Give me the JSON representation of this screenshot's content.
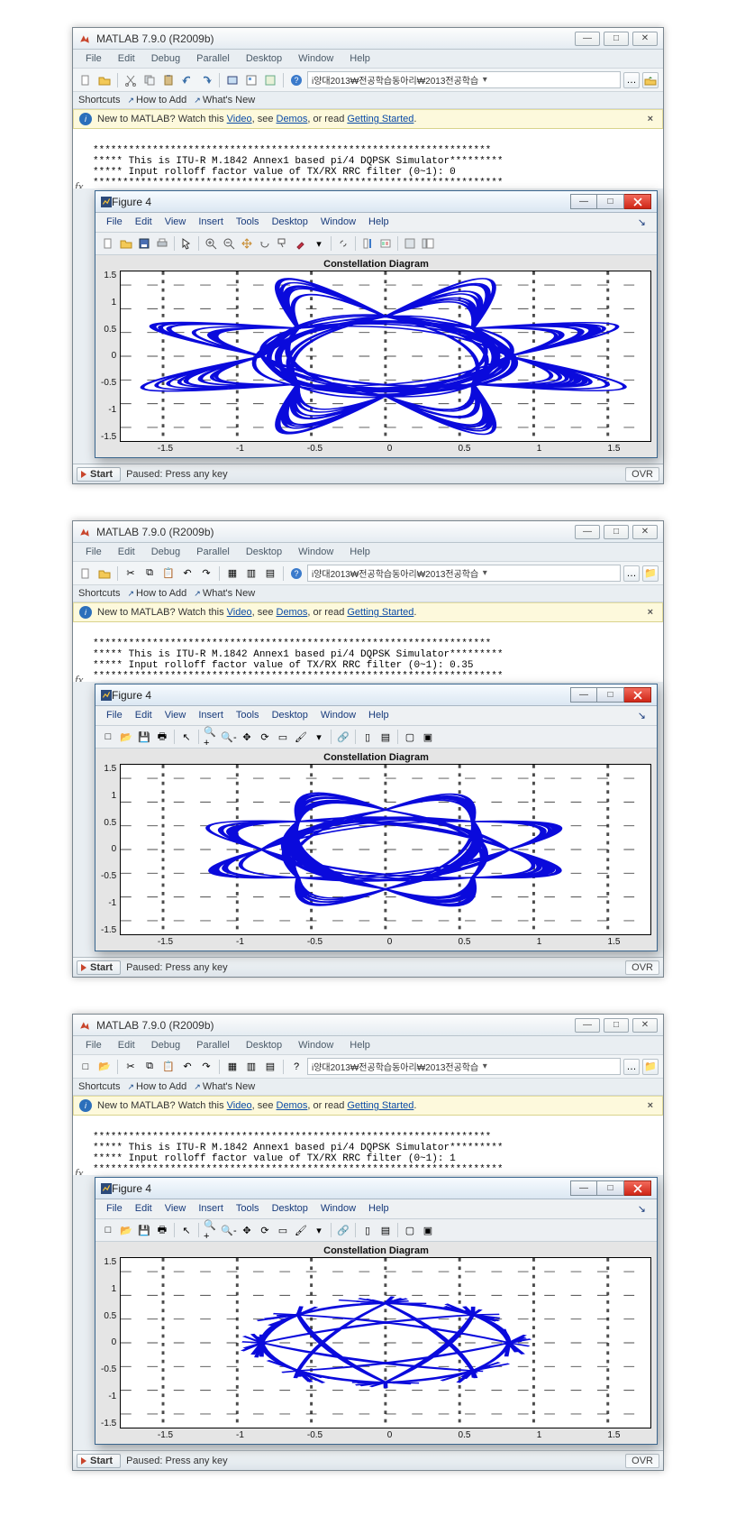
{
  "main": {
    "title": "MATLAB  7.9.0 (R2009b)",
    "menus": [
      "File",
      "Edit",
      "Debug",
      "Parallel",
      "Desktop",
      "Window",
      "Help"
    ],
    "shortcuts_label": "Shortcuts",
    "howto": "How to Add",
    "whatsnew": "What's New",
    "info_prefix": "New to MATLAB? Watch this ",
    "info_video": "Video",
    "info_mid": ", see ",
    "info_demos": "Demos",
    "info_mid2": ", or read ",
    "info_gs": "Getting Started",
    "info_suffix": ".",
    "path": "i양대2013₩전공학습동아리₩2013전공학습",
    "status": "Paused: Press any key",
    "start": "Start",
    "ovr": "OVR"
  },
  "figure": {
    "title": "Figure 4",
    "menus": [
      "File",
      "Edit",
      "View",
      "Insert",
      "Tools",
      "Desktop",
      "Window",
      "Help"
    ],
    "plot_title": "Constellation Diagram"
  },
  "console0": {
    "l1": "*******************************************************************",
    "l2": "***** This is ITU-R M.1842 Annex1 based pi/4 DQPSK Simulator*********",
    "l3": "***** Input rolloff factor value of TX/RX RRC filter (0~1): 0",
    "l4": "*********************************************************************"
  },
  "console1": {
    "l1": "*******************************************************************",
    "l2": "***** This is ITU-R M.1842 Annex1 based pi/4 DQPSK Simulator*********",
    "l3": "***** Input rolloff factor value of TX/RX RRC filter (0~1): 0.35",
    "l4": "*********************************************************************"
  },
  "console2": {
    "l1": "*******************************************************************",
    "l2": "***** This is ITU-R M.1842 Annex1 based pi/4 DQPSK Simulator*********",
    "l3": "***** Input rolloff factor value of TX/RX RRC filter (0~1): 1",
    "l4": "*********************************************************************"
  },
  "axes": {
    "y": [
      "1.5",
      "1",
      "0.5",
      "0",
      "-0.5",
      "-1",
      "-1.5"
    ],
    "x": [
      "-1.5",
      "-1",
      "-0.5",
      "0",
      "0.5",
      "1",
      "1.5"
    ]
  },
  "chart_data": [
    {
      "type": "line",
      "title": "Constellation Diagram",
      "xlim": [
        -1.8,
        1.8
      ],
      "ylim": [
        -1.8,
        1.8
      ],
      "note": "rolloff=0 — constellation trajectory, 8 nominal states at r≈1, very heavy ISI overshoot ~1.7",
      "nominal_states": [
        [
          1,
          0
        ],
        [
          0.707,
          0.707
        ],
        [
          0,
          1
        ],
        [
          -0.707,
          0.707
        ],
        [
          -1,
          0
        ],
        [
          -0.707,
          -0.707
        ],
        [
          0,
          -1
        ],
        [
          0.707,
          -0.707
        ]
      ],
      "overshoot_radius": 1.7
    },
    {
      "type": "line",
      "title": "Constellation Diagram",
      "xlim": [
        -1.8,
        1.8
      ],
      "ylim": [
        -1.8,
        1.8
      ],
      "note": "rolloff=0.35 — moderate ISI overshoot ~1.4; ring-hole visible at origin",
      "nominal_states": [
        [
          1,
          0
        ],
        [
          0.707,
          0.707
        ],
        [
          0,
          1
        ],
        [
          -0.707,
          0.707
        ],
        [
          -1,
          0
        ],
        [
          -0.707,
          -0.707
        ],
        [
          0,
          -1
        ],
        [
          0.707,
          -0.707
        ]
      ],
      "overshoot_radius": 1.4
    },
    {
      "type": "line",
      "title": "Constellation Diagram",
      "xlim": [
        -1.8,
        1.8
      ],
      "ylim": [
        -1.8,
        1.8
      ],
      "note": "rolloff=1 — near-Nyquist, transitions nearly straight, star polygon; minimal overshoot ~1.05",
      "nominal_states": [
        [
          1,
          0
        ],
        [
          0.707,
          0.707
        ],
        [
          0,
          1
        ],
        [
          -0.707,
          0.707
        ],
        [
          -1,
          0
        ],
        [
          -0.707,
          -0.707
        ],
        [
          0,
          -1
        ],
        [
          0.707,
          -0.707
        ]
      ],
      "overshoot_radius": 1.05
    }
  ]
}
